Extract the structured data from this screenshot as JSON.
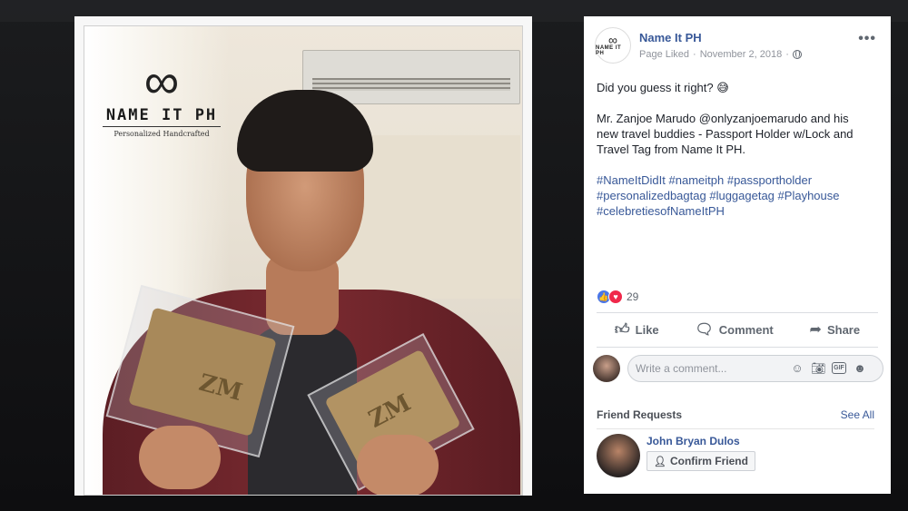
{
  "photo": {
    "watermark_title": "NAME IT PH",
    "watermark_sub": "Personalized Handcrafted",
    "monogram": "ZM"
  },
  "post": {
    "page_name": "Name It PH",
    "status": "Page Liked",
    "date": "November 2, 2018",
    "separator1": "·",
    "separator2": "·",
    "line1": "Did you guess it right? 😅",
    "line2": "Mr. Zanjoe Marudo @onlyzanjoemarudo and his new travel buddies - Passport Holder w/Lock and Travel Tag from Name It PH.",
    "hashtags": [
      "#NameItDidIt",
      "#nameitph",
      "#passportholder",
      "#personalizedbagtag",
      "#luggagetag",
      "#Playhouse",
      "#celebretiesofNameItPH"
    ],
    "reaction_count": "29"
  },
  "actions": {
    "like": "Like",
    "comment": "Comment",
    "share": "Share"
  },
  "comment": {
    "placeholder": "Write a comment..."
  },
  "friend_requests": {
    "title": "Friend Requests",
    "see_all": "See All",
    "name": "John Bryan Dulos",
    "confirm": "Confirm Friend"
  }
}
